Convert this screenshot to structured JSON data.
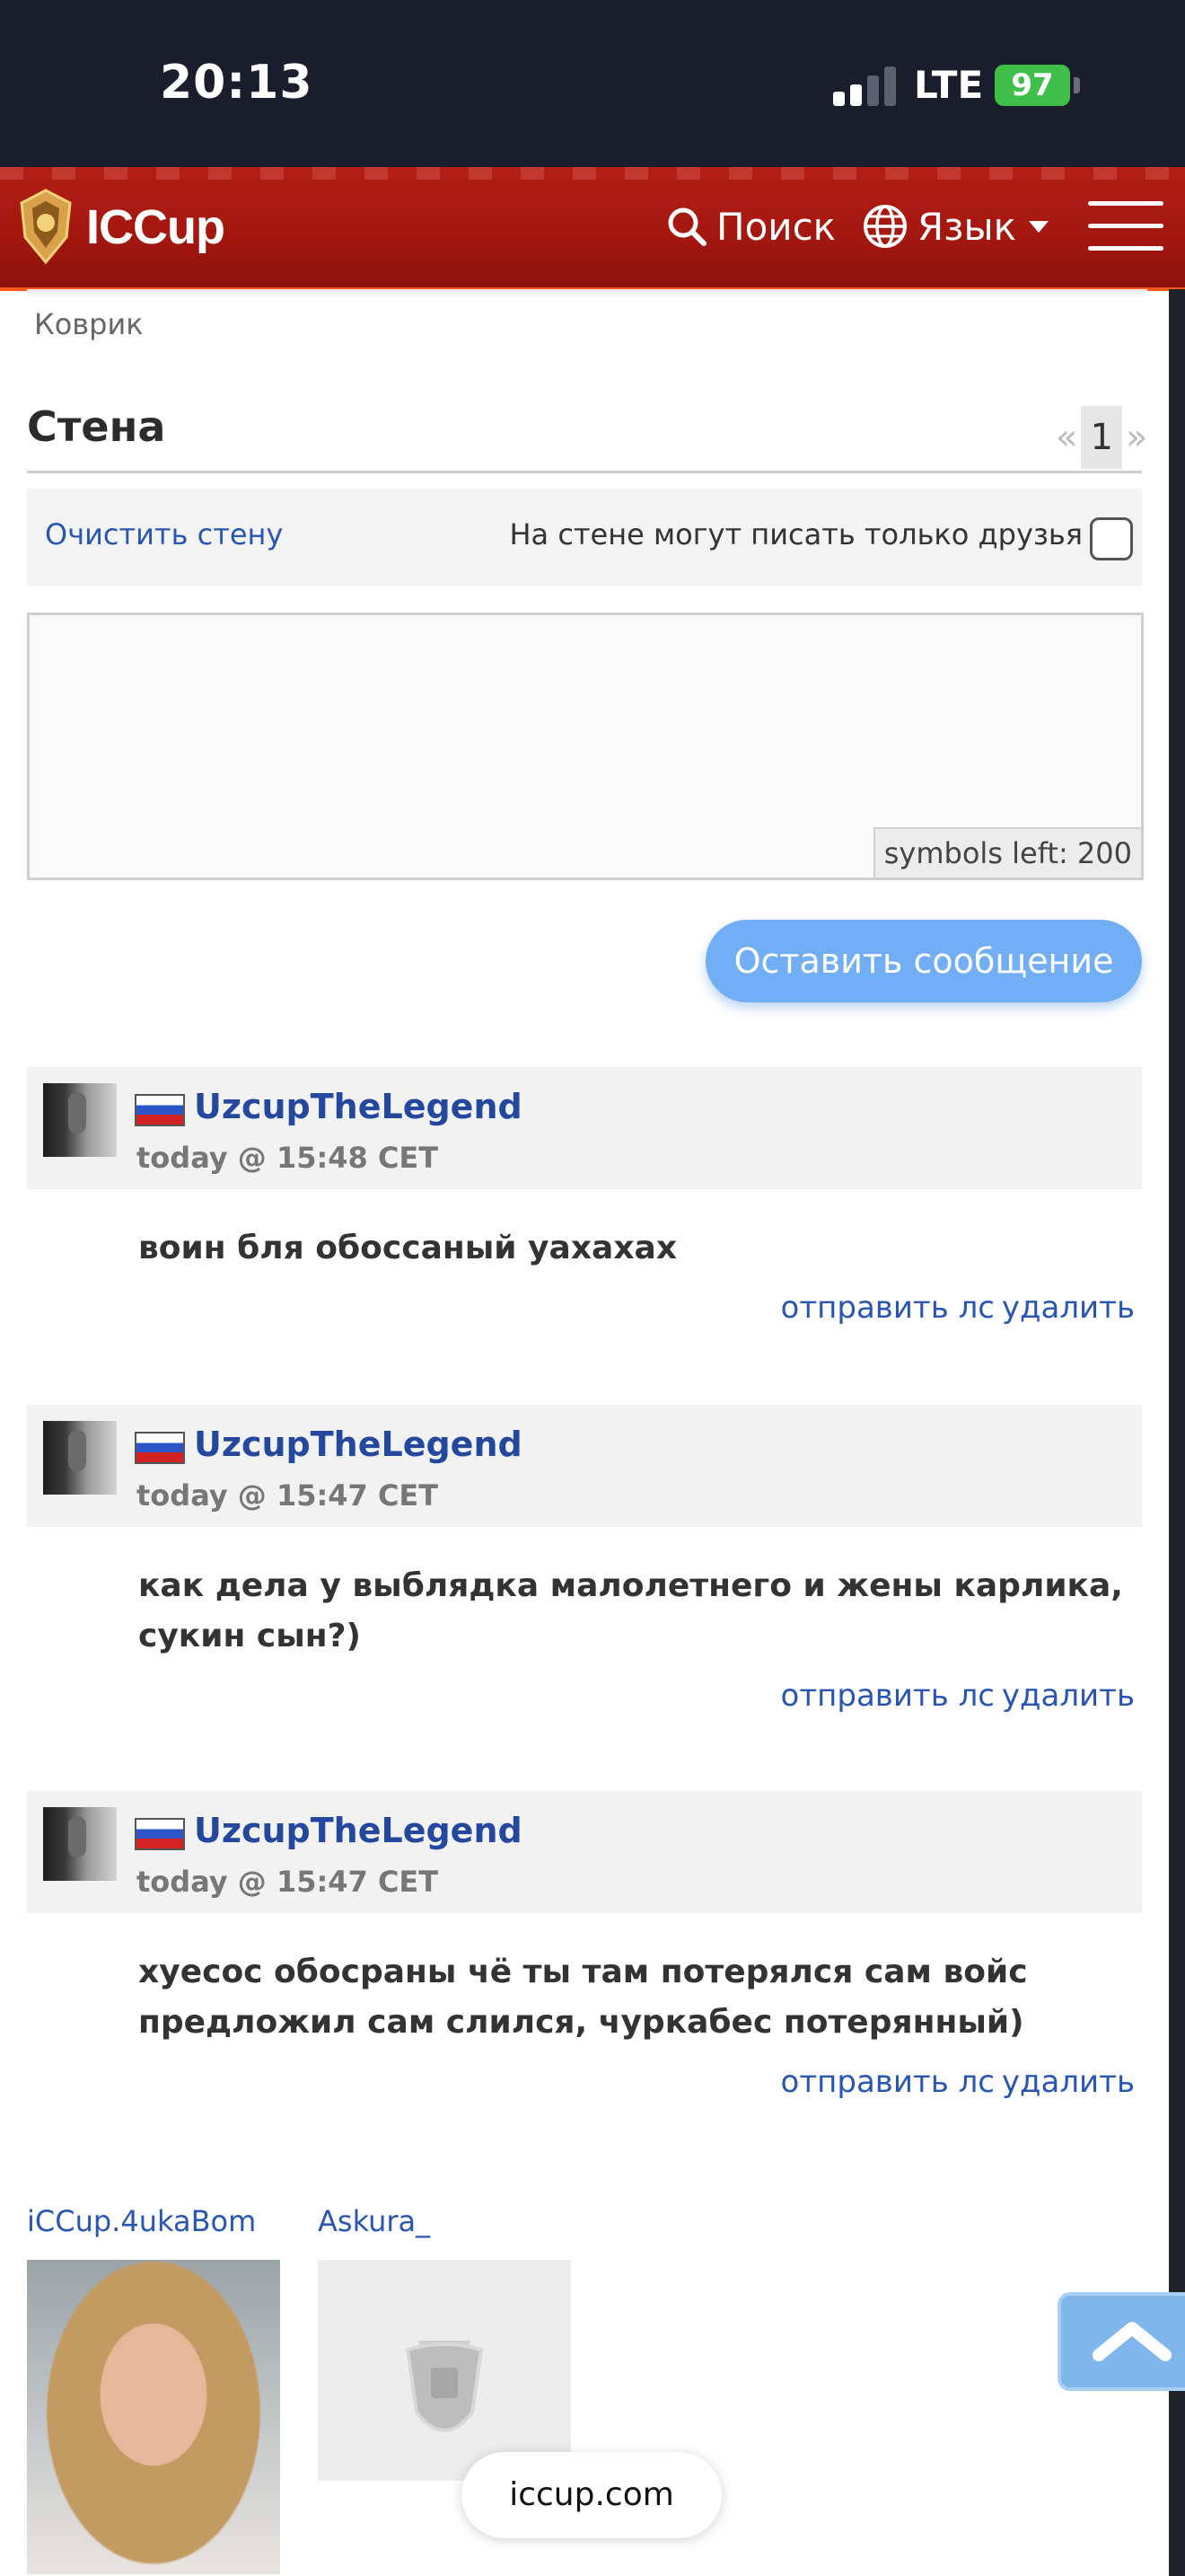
{
  "status_bar": {
    "time": "20:13",
    "network": "LTE",
    "battery": "97"
  },
  "header": {
    "logo_text": "ICCup",
    "search_label": "Поиск",
    "language_label": "Язык"
  },
  "breadcrumb": "Коврик",
  "wall": {
    "title": "Стена",
    "pager": {
      "prev": "«",
      "current": "1",
      "next": "»"
    },
    "clear_label": "Очистить стену",
    "friends_only_label": "На стене могут писать только друзья",
    "friends_only_checked": false,
    "input_value": "",
    "symbols_left": "symbols left: 200",
    "submit_label": "Оставить сообщение"
  },
  "posts": [
    {
      "author": "UzcupTheLegend",
      "date": "today @ 15:48 CET",
      "text": "воин бля обоссаный уахахах",
      "pm_label": "отправить лс",
      "delete_label": "удалить"
    },
    {
      "author": "UzcupTheLegend",
      "date": "today @ 15:47 CET",
      "text": "как дела у выблядка малолетнего и жены карлика, сукин сын?)",
      "pm_label": "отправить лс",
      "delete_label": "удалить"
    },
    {
      "author": "UzcupTheLegend",
      "date": "today @ 15:47 CET",
      "text": "хуесос обосраны чё ты там потерялся сам войс предложил сам слился, чуркабес потерянный)",
      "pm_label": "отправить лс",
      "delete_label": "удалить"
    }
  ],
  "friends": [
    {
      "name": "iCCup.4ukaBom"
    },
    {
      "name": "Askura_"
    }
  ],
  "browser": {
    "url": "iccup.com"
  },
  "colors": {
    "header_red": "#b21e14",
    "link_blue": "#2a56b3",
    "button_blue": "#71aef5"
  }
}
